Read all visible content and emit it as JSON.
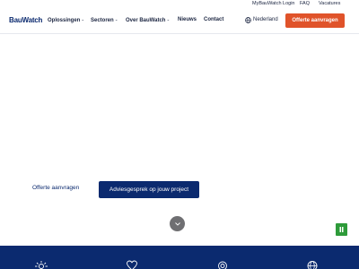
{
  "topbar": {
    "links": [
      "MyBauWatch Login",
      "FAQ",
      "Vacatures"
    ]
  },
  "header": {
    "logo": "BauWatch",
    "nav": [
      {
        "label": "Oplossingen",
        "has_dropdown": true
      },
      {
        "label": "Sectoren",
        "has_dropdown": true
      },
      {
        "label": "Over BauWatch",
        "has_dropdown": true
      },
      {
        "label": "Nieuws",
        "has_dropdown": false
      },
      {
        "label": "Contact",
        "has_dropdown": false
      }
    ],
    "language": "Nederland",
    "language_icon": "globe-icon",
    "cta": "Offerte aanvragen"
  },
  "hero": {
    "secondary_cta": "Offerte aanvragen",
    "primary_cta": "Adviesgesprek op jouw project",
    "scroll_icon": "chevron-down-icon",
    "pause_icon": "pause-icon"
  },
  "feature_band": {
    "icons": [
      "sun-icon",
      "heart-icon",
      "target-icon",
      "globe-icon"
    ]
  },
  "colors": {
    "brand_navy": "#0b2a6f",
    "accent_orange": "#e0532a",
    "pause_green": "#2e9b3a",
    "scroll_gray": "#6f6f72"
  }
}
